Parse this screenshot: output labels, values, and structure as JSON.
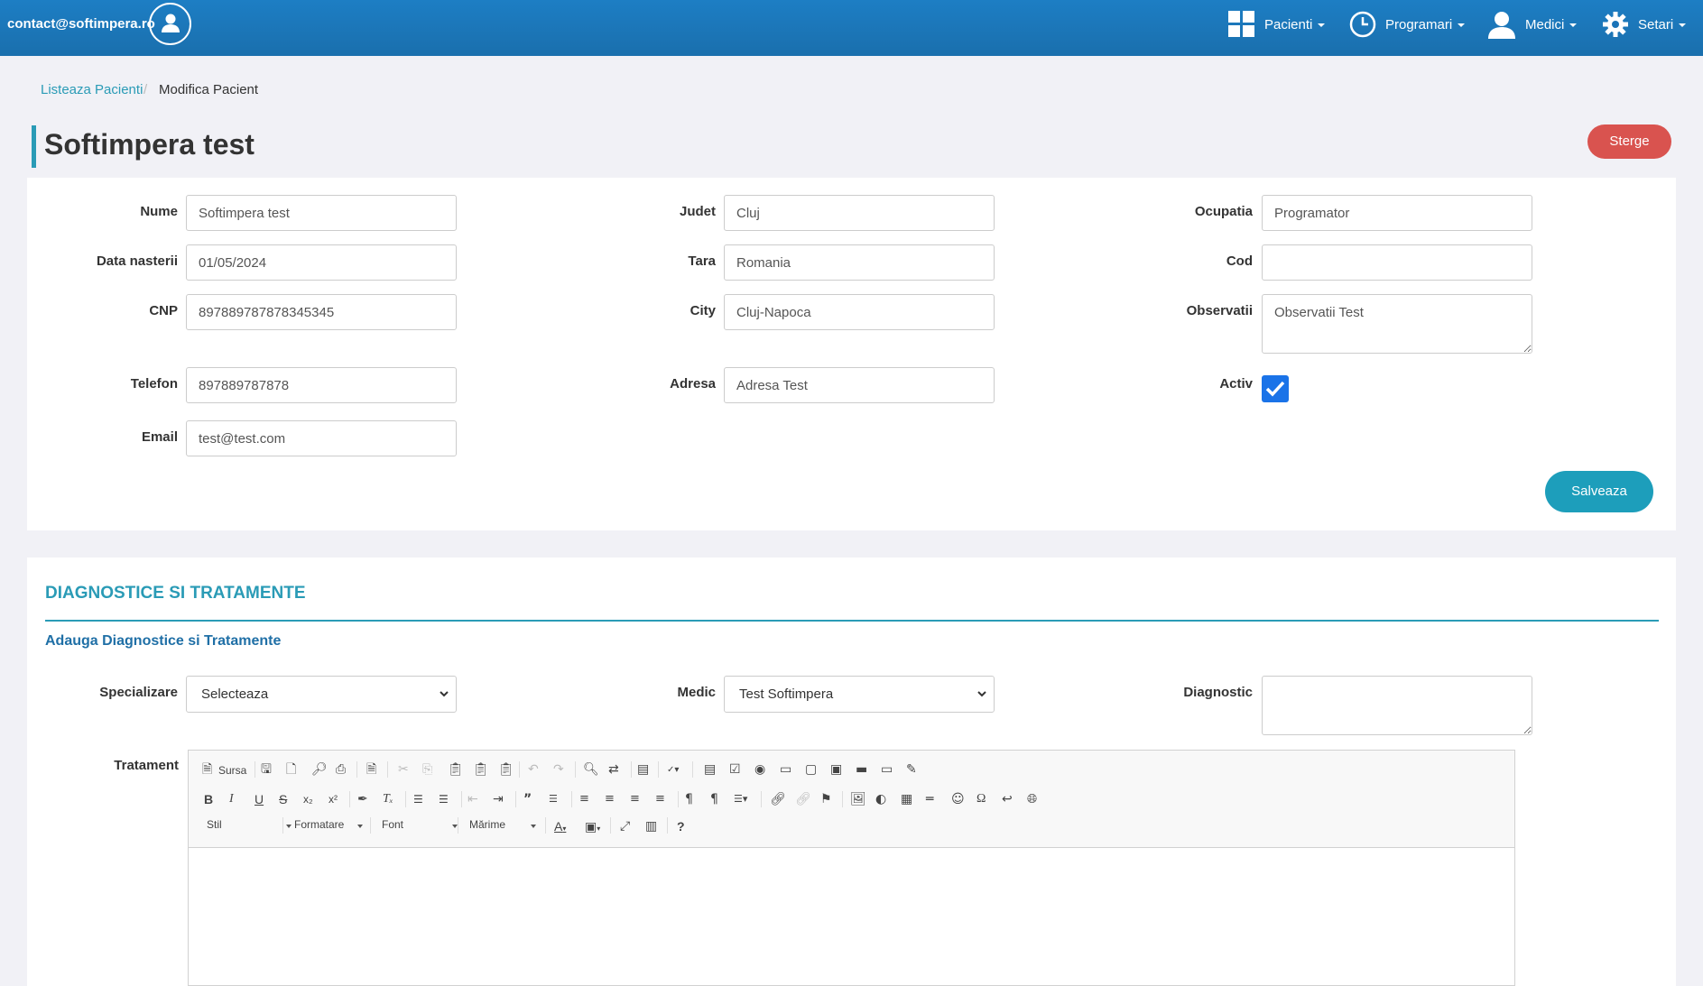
{
  "header": {
    "user_email": "contact@softimpera.ro",
    "nav": [
      {
        "label": "Pacienti",
        "icon": "grid-icon"
      },
      {
        "label": "Programari",
        "icon": "clock-icon"
      },
      {
        "label": "Medici",
        "icon": "user-icon"
      },
      {
        "label": "Setari",
        "icon": "gear-icon"
      }
    ]
  },
  "breadcrumb": {
    "link": "Listeaza Pacienti",
    "separator": "/",
    "current": "Modifica Pacient"
  },
  "page": {
    "title": "Softimpera test",
    "delete_label": "Sterge"
  },
  "form": {
    "nume": {
      "label": "Nume",
      "value": "Softimpera test"
    },
    "data_nasterii": {
      "label": "Data nasterii",
      "value": "01/05/2024"
    },
    "cnp": {
      "label": "CNP",
      "value": "897889787878345345"
    },
    "telefon": {
      "label": "Telefon",
      "value": "897889787878"
    },
    "email": {
      "label": "Email",
      "value": "test@test.com"
    },
    "judet": {
      "label": "Judet",
      "value": "Cluj"
    },
    "tara": {
      "label": "Tara",
      "value": "Romania"
    },
    "city": {
      "label": "City",
      "value": "Cluj-Napoca"
    },
    "adresa": {
      "label": "Adresa",
      "value": "Adresa Test"
    },
    "ocupatia": {
      "label": "Ocupatia",
      "value": "Programator"
    },
    "cod": {
      "label": "Cod",
      "value": ""
    },
    "observatii": {
      "label": "Observatii",
      "value": "Observatii Test"
    },
    "activ": {
      "label": "Activ",
      "checked": true
    },
    "save_label": "Salveaza"
  },
  "diagnostics": {
    "section_title": "DIAGNOSTICE SI TRATAMENTE",
    "subtitle": "Adauga Diagnostice si Tratamente",
    "specializare": {
      "label": "Specializare",
      "value": "Selecteaza"
    },
    "medic": {
      "label": "Medic",
      "value": "Test Softimpera"
    },
    "diagnostic": {
      "label": "Diagnostic",
      "value": ""
    },
    "tratament": {
      "label": "Tratament"
    }
  },
  "editor": {
    "source_label": "Sursa",
    "combos": {
      "style": "Stil",
      "format": "Formatare",
      "font": "Font",
      "size": "Mărime"
    }
  },
  "colors": {
    "header": "#1a73b8",
    "accent": "#2a9bb6",
    "danger": "#d9534f",
    "save": "#1d9ebb",
    "checkbox": "#1a73e8"
  }
}
